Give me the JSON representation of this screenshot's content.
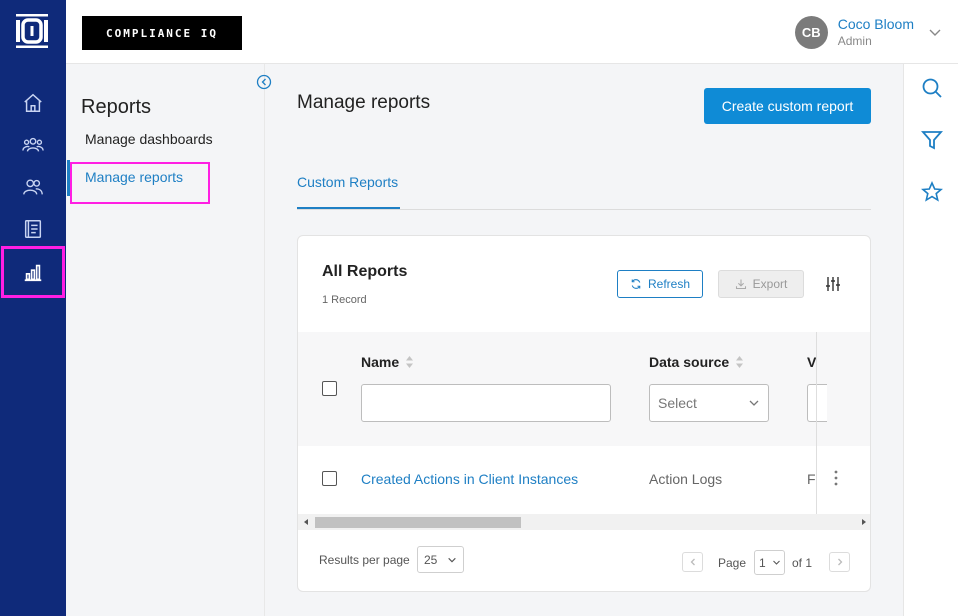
{
  "brand": {
    "logo_text": "COMPLIANCE IQ"
  },
  "user": {
    "initials": "CB",
    "name": "Coco Bloom",
    "role": "Admin"
  },
  "rail": {
    "items": [
      {
        "icon": "home-icon"
      },
      {
        "icon": "users-icon"
      },
      {
        "icon": "groups-icon"
      },
      {
        "icon": "document-icon"
      },
      {
        "icon": "bar-chart-icon",
        "active": true
      }
    ]
  },
  "subnav": {
    "title": "Reports",
    "items": [
      {
        "label": "Manage dashboards"
      },
      {
        "label": "Manage reports",
        "active": true
      }
    ]
  },
  "right_rail": {
    "items": [
      "search-icon",
      "filter-icon",
      "star-icon"
    ]
  },
  "main": {
    "title": "Manage reports",
    "create_label": "Create custom report",
    "tab_label": "Custom Reports",
    "card": {
      "title": "All Reports",
      "record_count": "1 Record",
      "refresh_label": "Refresh",
      "export_label": "Export",
      "columns": {
        "name": "Name",
        "data_source": "Data source",
        "partial": "V"
      },
      "data_source_placeholder": "Select",
      "rows": [
        {
          "name": "Created Actions in Client Instances",
          "data_source": "Action Logs",
          "partial": "F"
        }
      ],
      "footer": {
        "results_label": "Results per page",
        "per_page": "25",
        "page_label": "Page",
        "page_value": "1",
        "of_label": "of 1"
      }
    }
  },
  "colors": {
    "rail_bg": "#0f2a7a",
    "accent": "#1e7fc4",
    "primary_button": "#0f8bd6",
    "highlight": "#ff1fe3"
  }
}
